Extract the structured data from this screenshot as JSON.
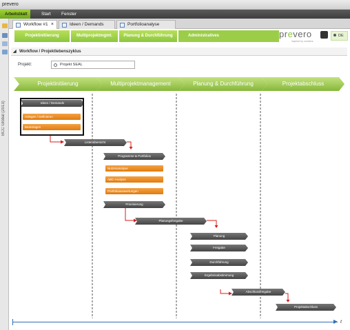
{
  "window": {
    "title": "prevero"
  },
  "menu": [
    "Arbeitsblatt",
    "Start",
    "Fenster"
  ],
  "tabs": [
    {
      "label": "Workflow #1",
      "close": "×"
    },
    {
      "label": "Ideen / Demands"
    },
    {
      "label": "Portfolioanalyse"
    }
  ],
  "sidebar": {
    "vertical_label": "BCC Global (2013)"
  },
  "topnav": [
    "Projektinitiierung",
    "Multiprojektmgmt.",
    "Planung & Durchführung",
    "Administratives"
  ],
  "brand": {
    "logo_pre": "pr",
    "logo_mid": "e",
    "logo_post": "vero",
    "tagline": "inspired by numbers"
  },
  "language": "DE",
  "section": {
    "title": "Workflow / Projektlebenszyklus"
  },
  "project": {
    "label": "Projekt:",
    "value": "Projekt SEAL"
  },
  "phases": [
    "Projektinitiierung",
    "Multiprojektmanagement",
    "Planung & Durchführung",
    "Projektabschluss"
  ],
  "steps": {
    "ideen": "Ideen / Demands",
    "listen": "Listenübersicht",
    "programme": "Programme & Portfolios",
    "priorisierung": "Priorisierung",
    "planungsfreigabe": "Planungsfreigabe",
    "planung": "Planung",
    "freigabe": "Freigabe",
    "durchfuehrung": "Durchführung",
    "ergebnis": "Ergebnisabstimmung",
    "abschlussfreigabe": "Abschlussfreigabe",
    "projektabschluss": "Projektabschluss"
  },
  "orange": {
    "anlegen": "Anlegen / Definieren",
    "beantragen": "Beantragen",
    "nutzen": "Nutzenanalyse",
    "abc": "ABC-Analyse",
    "portfolio": "Portfolioauswertungen"
  },
  "timeline": {
    "label": "t"
  }
}
